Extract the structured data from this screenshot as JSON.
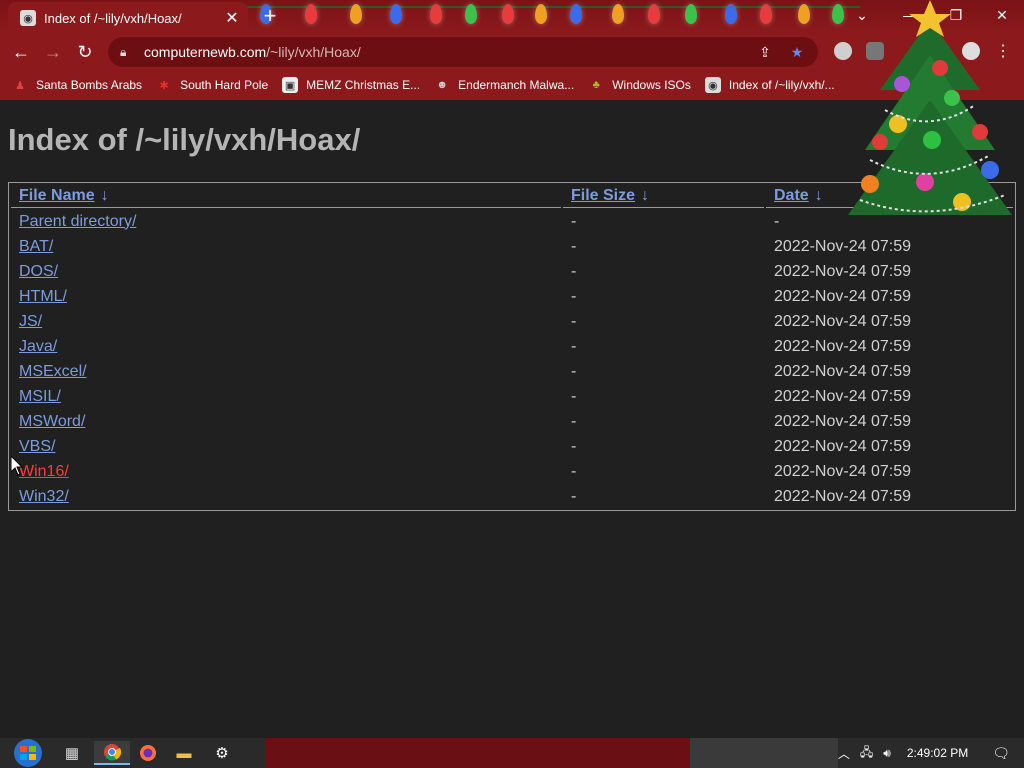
{
  "browser": {
    "tab_title": "Index of /~lily/vxh/Hoax/",
    "tab_close": "✕",
    "new_tab": "+",
    "url_host": "computernewb.com",
    "url_path": "/~lily/vxh/Hoax/",
    "window_controls": {
      "chevron": "⌄",
      "minimize": "—",
      "restore": "❐",
      "close": "✕"
    },
    "nav": {
      "back": "←",
      "forward": "→",
      "reload": "↻"
    }
  },
  "bookmarks": [
    {
      "label": "Santa Bombs Arabs",
      "icon": "santa-icon",
      "color": "#c0392b"
    },
    {
      "label": "South Hard Pole",
      "icon": "star-burst-icon",
      "color": "#d83030"
    },
    {
      "label": "MEMZ Christmas E...",
      "icon": "window-icon",
      "color": "#e0e0e0"
    },
    {
      "label": "Endermanch Malwa...",
      "icon": "raccoon-icon",
      "color": "#9a9a9a"
    },
    {
      "label": "Windows ISOs",
      "icon": "tree-icon",
      "color": "#7a9a20"
    },
    {
      "label": "Index of /~lily/vxh/...",
      "icon": "globe-icon",
      "color": "#dcdcdc"
    }
  ],
  "page": {
    "heading": "Index of /~lily/vxh/Hoax/",
    "columns": {
      "name": "File Name",
      "size": "File Size",
      "date": "Date",
      "sort_arrow": "↓"
    },
    "rows": [
      {
        "name": "Parent directory/",
        "size": "-",
        "date": "-"
      },
      {
        "name": "BAT/",
        "size": "-",
        "date": "2022-Nov-24 07:59"
      },
      {
        "name": "DOS/",
        "size": "-",
        "date": "2022-Nov-24 07:59"
      },
      {
        "name": "HTML/",
        "size": "-",
        "date": "2022-Nov-24 07:59"
      },
      {
        "name": "JS/",
        "size": "-",
        "date": "2022-Nov-24 07:59"
      },
      {
        "name": "Java/",
        "size": "-",
        "date": "2022-Nov-24 07:59"
      },
      {
        "name": "MSExcel/",
        "size": "-",
        "date": "2022-Nov-24 07:59"
      },
      {
        "name": "MSIL/",
        "size": "-",
        "date": "2022-Nov-24 07:59"
      },
      {
        "name": "MSWord/",
        "size": "-",
        "date": "2022-Nov-24 07:59"
      },
      {
        "name": "VBS/",
        "size": "-",
        "date": "2022-Nov-24 07:59"
      },
      {
        "name": "Win16/",
        "size": "-",
        "date": "2022-Nov-24 07:59"
      },
      {
        "name": "Win32/",
        "size": "-",
        "date": "2022-Nov-24 07:59"
      }
    ]
  },
  "taskbar": {
    "clock": "2:49:02 PM",
    "tray_chevron": "︿"
  },
  "colors": {
    "link": "#7c9cde",
    "link_hover": "#ff3b3b",
    "chrome_red": "#8c1a1c"
  }
}
